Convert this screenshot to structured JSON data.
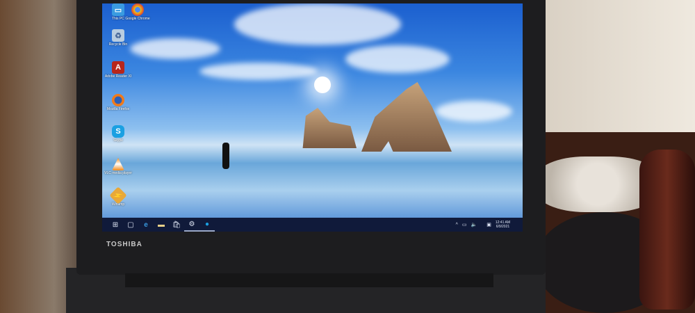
{
  "laptop": {
    "brand": "TOSHIBA"
  },
  "desktop_icons": [
    {
      "label": "This PC",
      "icon": "this-pc-icon"
    },
    {
      "label": "Google Chrome",
      "icon": "chrome-icon"
    },
    {
      "label": "Recycle Bin",
      "icon": "recycle-bin-icon"
    },
    {
      "label": "Adobe Reader XI",
      "icon": "adobe-reader-icon"
    },
    {
      "label": "Mozilla Firefox",
      "icon": "firefox-icon"
    },
    {
      "label": "Skype",
      "icon": "skype-icon"
    },
    {
      "label": "VLC media player",
      "icon": "vlc-icon"
    },
    {
      "label": "Winamp",
      "icon": "winamp-icon"
    }
  ],
  "taskbar": {
    "items": [
      "start",
      "task-view",
      "edge",
      "file-explorer",
      "store",
      "settings",
      "skype"
    ],
    "tray": {
      "chevron": "^",
      "time": "12:41 AM",
      "date": "6/9/2021"
    }
  }
}
